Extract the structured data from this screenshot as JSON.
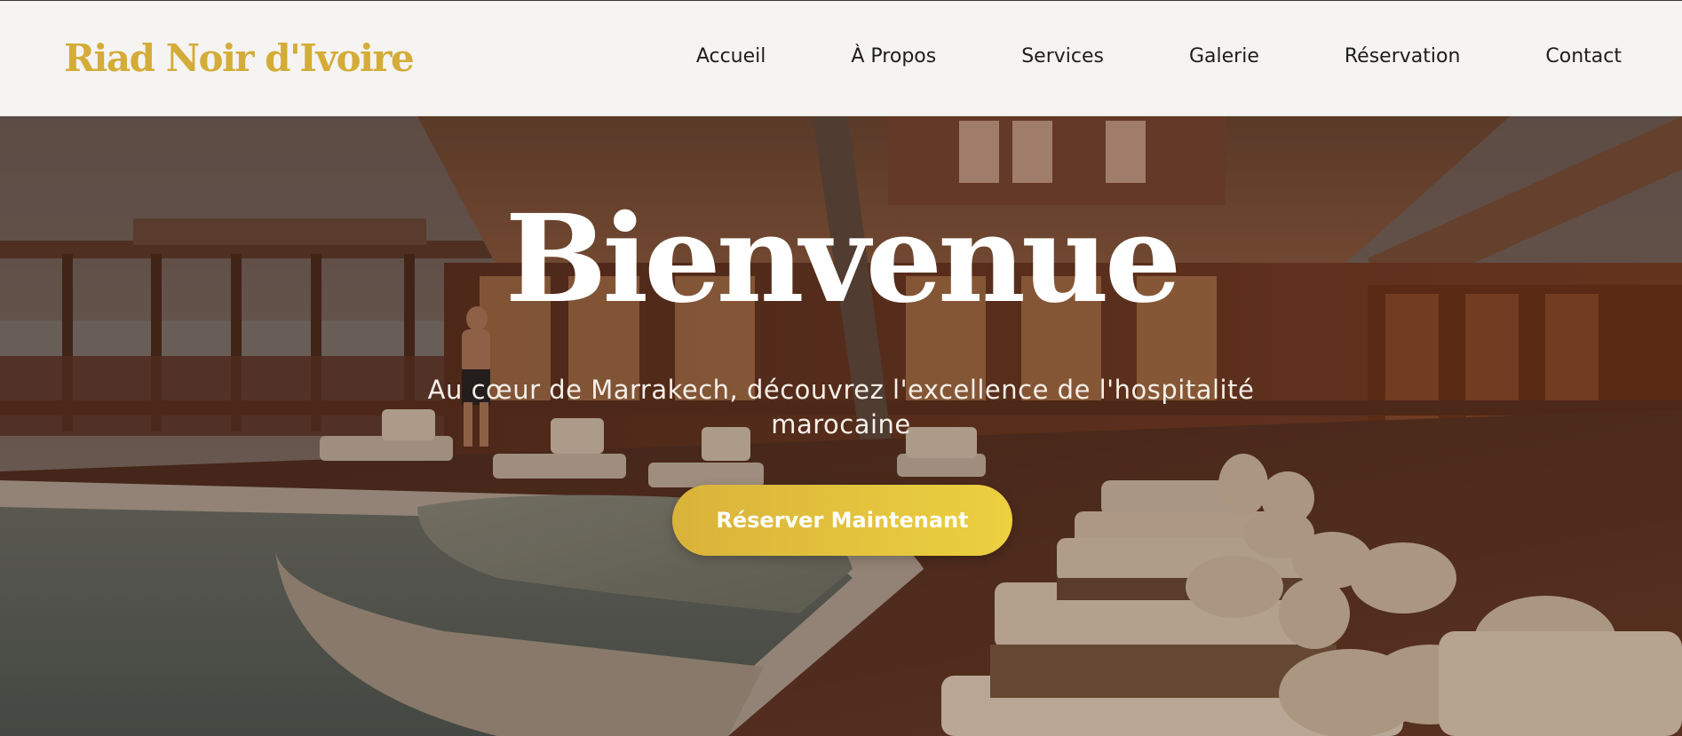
{
  "header": {
    "logo_text": "Riad Noir d'Ivoire"
  },
  "nav": {
    "items": [
      {
        "label": "Accueil"
      },
      {
        "label": "À Propos"
      },
      {
        "label": "Services"
      },
      {
        "label": "Galerie"
      },
      {
        "label": "Réservation"
      },
      {
        "label": "Contact"
      }
    ]
  },
  "hero": {
    "title": "Bienvenue",
    "subtitle": "Au cœur de Marrakech, découvrez l'excellence de l'hospitalité marocaine",
    "cta_label": "Réserver Maintenant",
    "background_description": "resort pool deck with wooden lodge, lounge chairs and palm tree at dusk"
  },
  "colors": {
    "brand_gold": "#d4ac38",
    "cta_gradient_start": "#d9b33a",
    "cta_gradient_end": "#ecd040",
    "header_bg": "#f5f4f2",
    "nav_text": "#1e1e1e"
  }
}
